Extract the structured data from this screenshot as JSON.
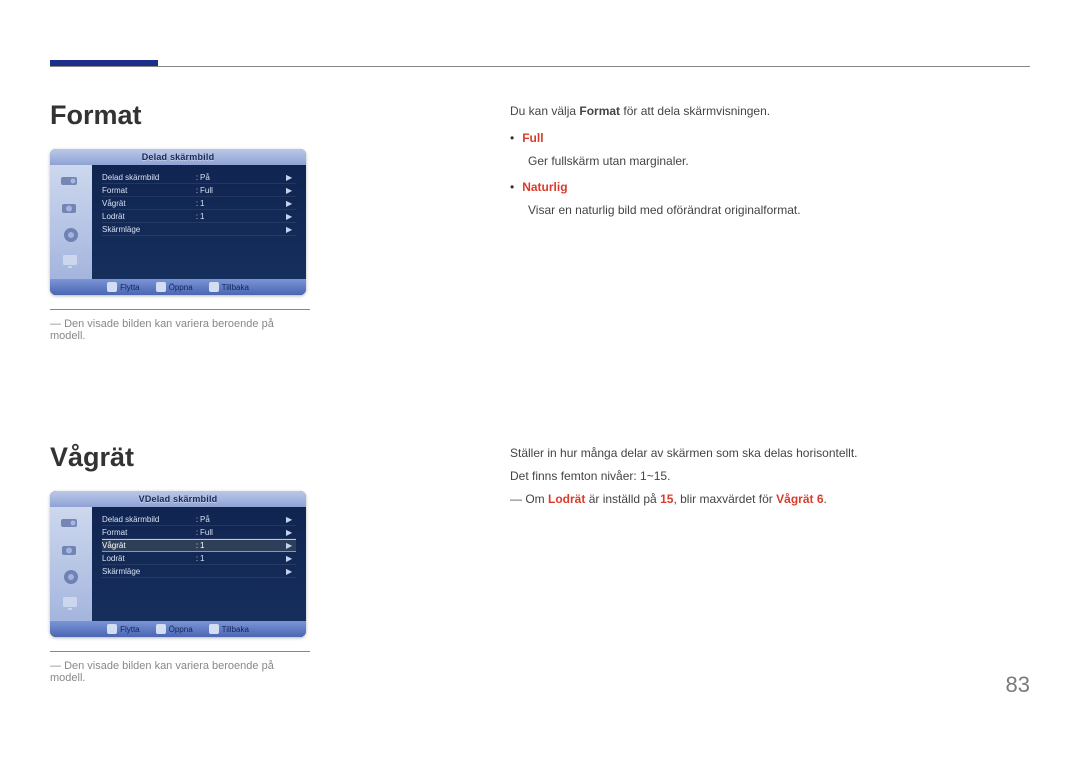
{
  "page_number": "83",
  "section1": {
    "heading": "Format",
    "osd_title": "Delad skärmbild",
    "rows": [
      {
        "label": "Delad skärmbild",
        "value": "På",
        "arrow": true,
        "selected": false
      },
      {
        "label": "Format",
        "value": "Full",
        "arrow": true,
        "selected": false
      },
      {
        "label": "Vågrät",
        "value": "1",
        "arrow": true,
        "selected": false
      },
      {
        "label": "Lodrät",
        "value": "1",
        "arrow": true,
        "selected": false
      },
      {
        "label": "Skärmläge",
        "value": "",
        "arrow": true,
        "selected": false
      }
    ],
    "footer": {
      "move": "Flytta",
      "enter": "Öppna",
      "return": "Tillbaka"
    },
    "caption": "Den visade bilden kan variera beroende på modell.",
    "intro_pre": "Du kan välja ",
    "intro_bold": "Format",
    "intro_post": " för att dela skärmvisningen.",
    "full_label": "Full",
    "full_desc": "Ger fullskärm utan marginaler.",
    "naturlig_label": "Naturlig",
    "naturlig_desc": "Visar en naturlig bild med oförändrat originalformat."
  },
  "section2": {
    "heading": "Vågrät",
    "osd_title": "VDelad skärmbild",
    "rows": [
      {
        "label": "Delad skärmbild",
        "value": "På",
        "arrow": true,
        "selected": false
      },
      {
        "label": "Format",
        "value": "Full",
        "arrow": true,
        "selected": false
      },
      {
        "label": "Vågrät",
        "value": "1",
        "arrow": true,
        "selected": true
      },
      {
        "label": "Lodrät",
        "value": "1",
        "arrow": true,
        "selected": false
      },
      {
        "label": "Skärmläge",
        "value": "",
        "arrow": true,
        "selected": false
      }
    ],
    "footer": {
      "move": "Flytta",
      "enter": "Öppna",
      "return": "Tillbaka"
    },
    "caption": "Den visade bilden kan variera beroende på modell.",
    "desc1": "Ställer in hur många delar av skärmen som ska delas horisontellt.",
    "desc2": "Det finns femton nivåer: 1~15.",
    "note_pre": "Om ",
    "note_b1": "Lodrät",
    "note_mid": " är inställd på ",
    "note_b2": "15",
    "note_mid2": ", blir maxvärdet för ",
    "note_b3": "Vågrät 6",
    "note_post": "."
  }
}
